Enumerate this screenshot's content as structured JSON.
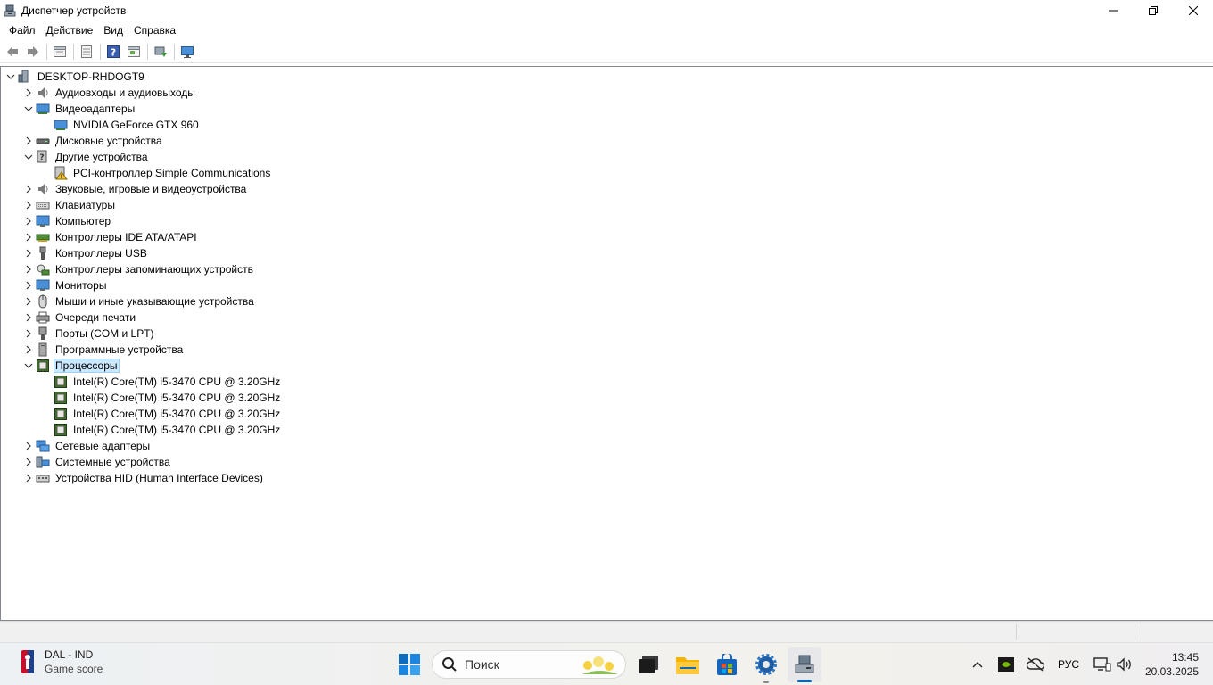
{
  "window": {
    "title": "Диспетчер устройств"
  },
  "menu": [
    "Файл",
    "Действие",
    "Вид",
    "Справка"
  ],
  "toolbar_icons": [
    "back-arrow-icon",
    "forward-arrow-icon",
    "properties-icon",
    "list-view-icon",
    "help-icon",
    "device-view-icon",
    "update-driver-icon",
    "monitor-scan-icon"
  ],
  "tree": {
    "root": "DESKTOP-RHDOGT9",
    "categories": [
      {
        "label": "Аудиовходы и аудиовыходы",
        "expanded": false
      },
      {
        "label": "Видеоадаптеры",
        "expanded": true,
        "children": [
          "NVIDIA GeForce GTX 960"
        ]
      },
      {
        "label": "Дисковые устройства",
        "expanded": false
      },
      {
        "label": "Другие устройства",
        "expanded": true,
        "children": [
          "PCI-контроллер Simple Communications"
        ]
      },
      {
        "label": "Звуковые, игровые и видеоустройства",
        "expanded": false
      },
      {
        "label": "Клавиатуры",
        "expanded": false
      },
      {
        "label": "Компьютер",
        "expanded": false
      },
      {
        "label": "Контроллеры IDE ATA/ATAPI",
        "expanded": false
      },
      {
        "label": "Контроллеры USB",
        "expanded": false
      },
      {
        "label": "Контроллеры запоминающих устройств",
        "expanded": false
      },
      {
        "label": "Мониторы",
        "expanded": false
      },
      {
        "label": "Мыши и иные указывающие устройства",
        "expanded": false
      },
      {
        "label": "Очереди печати",
        "expanded": false
      },
      {
        "label": "Порты (COM и LPT)",
        "expanded": false
      },
      {
        "label": "Программные устройства",
        "expanded": false
      },
      {
        "label": "Процессоры",
        "expanded": true,
        "selected": true,
        "children": [
          "Intel(R) Core(TM) i5-3470 CPU @ 3.20GHz",
          "Intel(R) Core(TM) i5-3470 CPU @ 3.20GHz",
          "Intel(R) Core(TM) i5-3470 CPU @ 3.20GHz",
          "Intel(R) Core(TM) i5-3470 CPU @ 3.20GHz"
        ]
      },
      {
        "label": "Сетевые адаптеры",
        "expanded": false
      },
      {
        "label": "Системные устройства",
        "expanded": false
      },
      {
        "label": "Устройства HID (Human Interface Devices)",
        "expanded": false
      }
    ]
  },
  "taskbar": {
    "widget_title": "DAL - IND",
    "widget_subtitle": "Game score",
    "search_placeholder": "Поиск",
    "language": "РУС",
    "time": "13:45",
    "date": "20.03.2025"
  },
  "colors": {
    "selection_bg": "#cce8ff",
    "selection_border": "#99d1ff",
    "accent": "#0067c0"
  }
}
